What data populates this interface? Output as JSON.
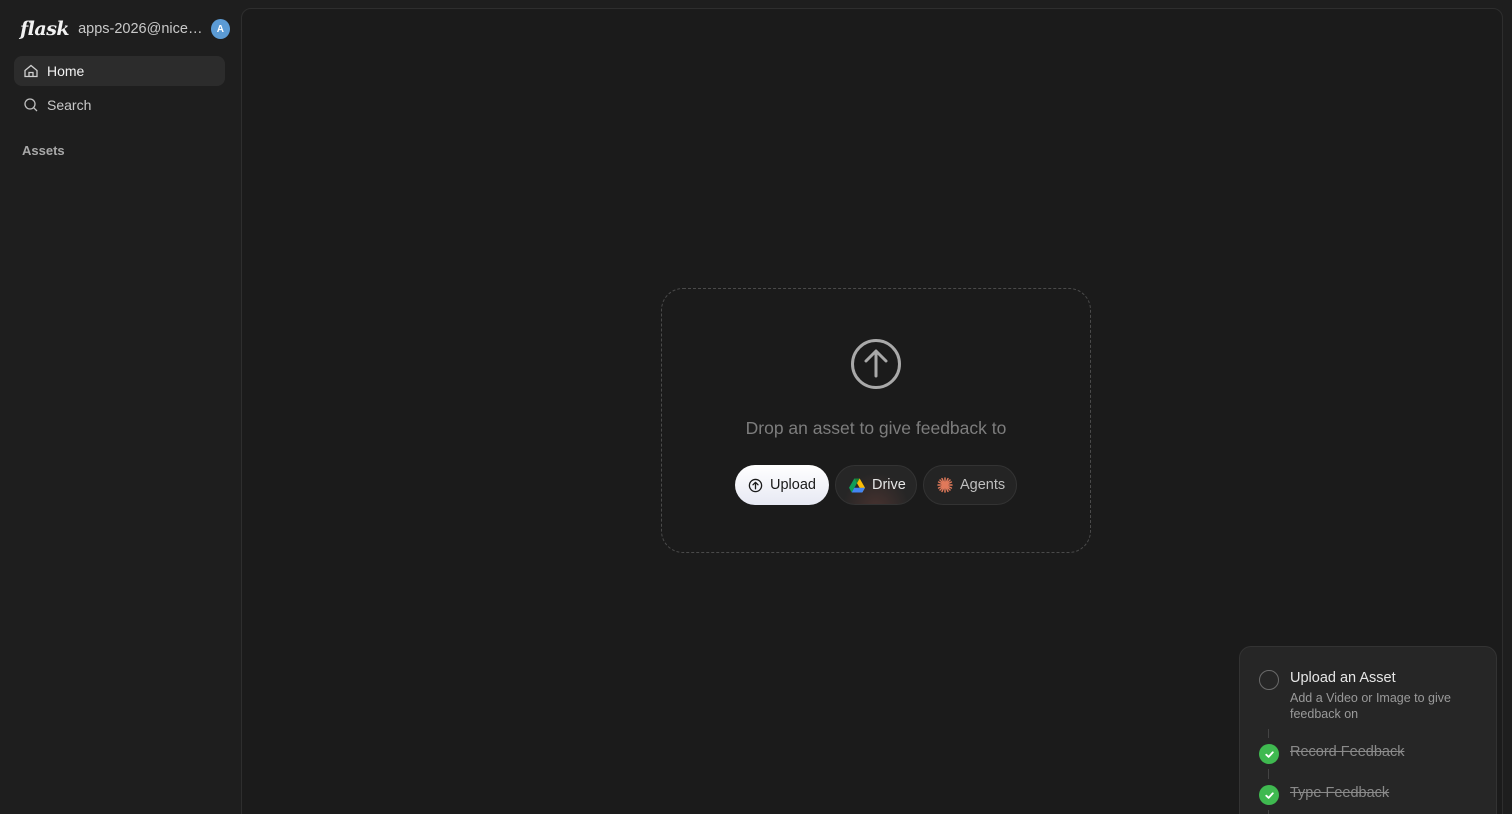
{
  "sidebar": {
    "logo": "flask",
    "account": "apps-2026@nicely...",
    "avatar_initial": "A",
    "nav": [
      {
        "label": "Home",
        "icon": "home-icon",
        "active": true
      },
      {
        "label": "Search",
        "icon": "search-icon",
        "active": false
      }
    ],
    "section_label": "Assets"
  },
  "dropzone": {
    "icon": "upload-arrow-icon",
    "text": "Drop an asset to give feedback to",
    "buttons": {
      "upload": "Upload",
      "drive": "Drive",
      "agents": "Agents"
    }
  },
  "checklist": {
    "steps": [
      {
        "title": "Upload an Asset",
        "description": "Add a Video or Image to give feedback on",
        "done": false
      },
      {
        "title": "Record Feedback",
        "done": true
      },
      {
        "title": "Type Feedback",
        "done": true
      }
    ]
  },
  "colors": {
    "background": "#1e1e1e",
    "avatar": "#5b9bd5",
    "check_done": "#3fb950",
    "agents_accent": "#e0795a"
  }
}
